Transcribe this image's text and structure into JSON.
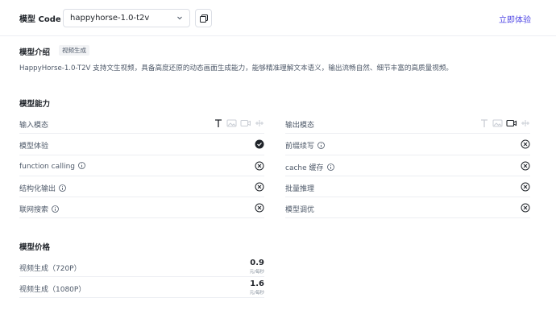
{
  "header": {
    "code_label": "模型 Code",
    "model_select": {
      "value": "happyhorse-1.0-t2v"
    },
    "try_label": "立即体验"
  },
  "intro": {
    "title": "模型介绍",
    "tag": "视频生成",
    "description": "HappyHorse-1.0-T2V 支持文生视频，具备高度还原的动态画面生成能力，能够精准理解文本语义，输出流畅自然、细节丰富的高质量视频。"
  },
  "capabilities": {
    "title": "模型能力",
    "left": {
      "header": "输入模态",
      "modalities": [
        {
          "icon": "text-icon",
          "active": true
        },
        {
          "icon": "image-icon",
          "active": false
        },
        {
          "icon": "video-icon",
          "active": false
        },
        {
          "icon": "audio-icon",
          "active": false
        }
      ],
      "rows": [
        {
          "label": "模型体验",
          "info": false,
          "supported": true
        },
        {
          "label": "function calling",
          "info": true,
          "supported": false
        },
        {
          "label": "结构化输出",
          "info": true,
          "supported": false
        },
        {
          "label": "联网搜索",
          "info": true,
          "supported": false
        }
      ]
    },
    "right": {
      "header": "输出模态",
      "modalities": [
        {
          "icon": "text-icon",
          "active": false
        },
        {
          "icon": "image-icon",
          "active": false
        },
        {
          "icon": "video-icon",
          "active": true
        },
        {
          "icon": "audio-icon",
          "active": false
        }
      ],
      "rows": [
        {
          "label": "前缀续写",
          "info": true,
          "supported": false
        },
        {
          "label": "cache 缓存",
          "info": true,
          "supported": false
        },
        {
          "label": "批量推理",
          "info": false,
          "supported": false
        },
        {
          "label": "模型调优",
          "info": false,
          "supported": false
        }
      ]
    }
  },
  "pricing": {
    "title": "模型价格",
    "rows": [
      {
        "label": "视频生成（720P）",
        "value": "0.9",
        "unit": "元/每秒"
      },
      {
        "label": "视频生成（1080P）",
        "value": "1.6",
        "unit": "元/每秒"
      }
    ]
  },
  "colors": {
    "accent": "#4f46e5",
    "text": "#1f2329",
    "muted": "#4e5969",
    "divider": "#eceef2"
  }
}
